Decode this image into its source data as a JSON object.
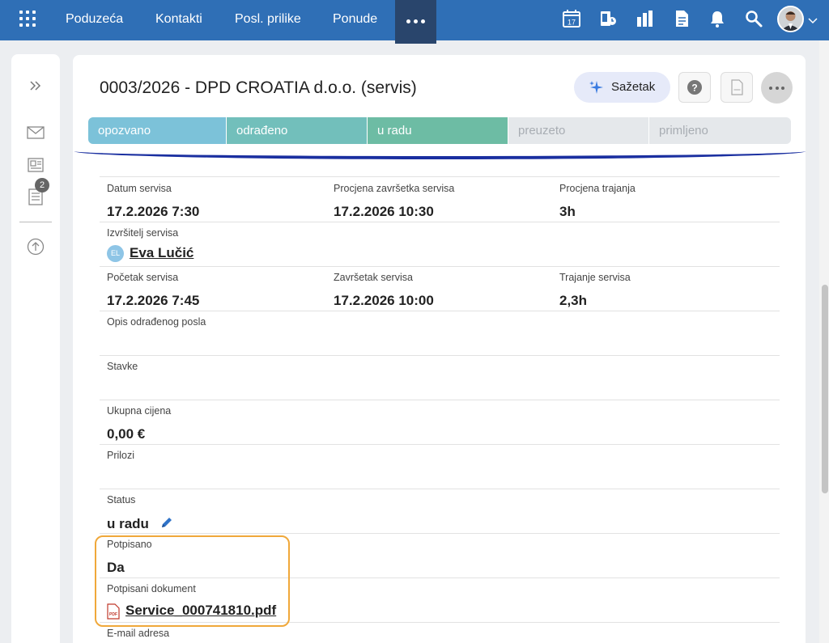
{
  "nav": {
    "items": [
      {
        "label": "Poduzeća"
      },
      {
        "label": "Kontakti"
      },
      {
        "label": "Posl. prilike"
      },
      {
        "label": "Ponude"
      }
    ],
    "calendar_day": "17"
  },
  "rail": {
    "badge_count": "2"
  },
  "record": {
    "title": "0003/2026 - DPD CROATIA d.o.o. (servis)",
    "summary_button": "Sažetak",
    "stages": [
      "opozvano",
      "odrađeno",
      "u radu",
      "preuzeto",
      "primljeno"
    ],
    "active_stage": "u radu"
  },
  "fields": {
    "datum_servisa": {
      "label": "Datum servisa",
      "value": "17.2.2026 7:30"
    },
    "procjena_zavrsetka": {
      "label": "Procjena završetka servisa",
      "value": "17.2.2026 10:30"
    },
    "procjena_trajanja": {
      "label": "Procjena trajanja",
      "value": "3h"
    },
    "izvrsitelj": {
      "label": "Izvršitelj servisa",
      "initials": "EL",
      "value": "Eva Lučić"
    },
    "pocetak": {
      "label": "Početak servisa",
      "value": "17.2.2026 7:45"
    },
    "zavrsetak": {
      "label": "Završetak servisa",
      "value": "17.2.2026 10:00"
    },
    "trajanje": {
      "label": "Trajanje servisa",
      "value": "2,3h"
    },
    "opis": {
      "label": "Opis odrađenog posla",
      "value": ""
    },
    "stavke": {
      "label": "Stavke",
      "value": ""
    },
    "ukupna_cijena": {
      "label": "Ukupna cijena",
      "value": "0,00 €"
    },
    "prilozi": {
      "label": "Prilozi",
      "value": ""
    },
    "status": {
      "label": "Status",
      "value": "u radu"
    },
    "potpisano": {
      "label": "Potpisano",
      "value": "Da"
    },
    "potpisani_dokument": {
      "label": "Potpisani dokument",
      "value": "Service_000741810.pdf"
    },
    "email": {
      "label": "E-mail adresa",
      "value": ""
    }
  },
  "colors": {
    "topbar": "#2f6fb6",
    "highlight": "#f0a83a",
    "stage_underline": "#1a2fa0"
  }
}
